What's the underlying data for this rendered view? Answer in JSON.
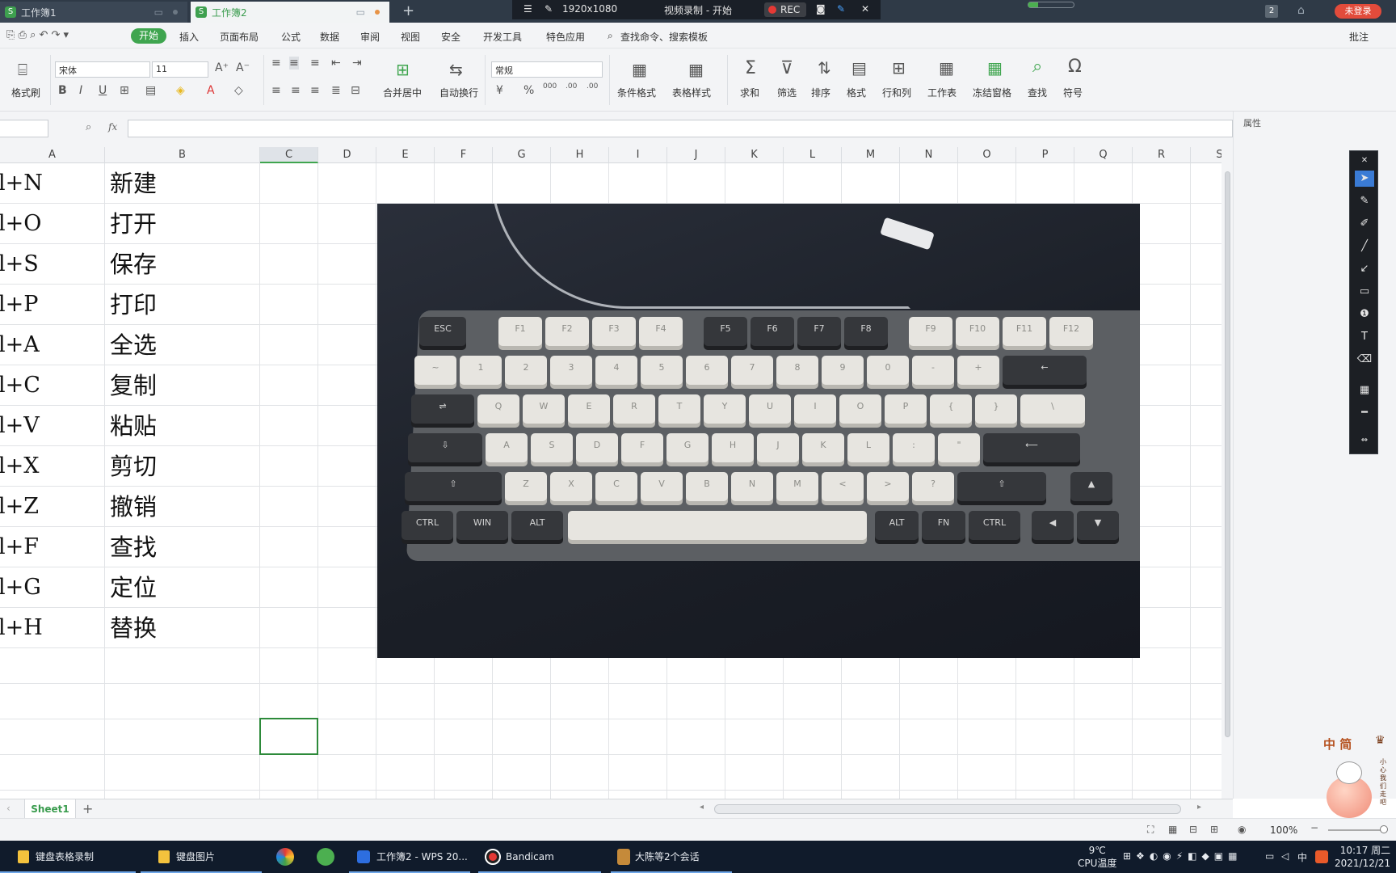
{
  "titlebar": {
    "tabs": [
      {
        "label": "工作簿1",
        "active": false
      },
      {
        "label": "工作簿2",
        "active": true
      }
    ],
    "new_tab": "+",
    "window_count": "2",
    "login_label": "未登录"
  },
  "recorder": {
    "menu_icon": "menu-icon",
    "pin_icon": "pin-icon",
    "resolution": "1920x1080",
    "title": "视频录制 - 开始",
    "rec_label": "REC",
    "camera_icon": "camera-icon",
    "pen_icon": "pen-icon",
    "close_icon": "close-icon"
  },
  "menu": {
    "items": [
      "开始",
      "插入",
      "页面布局",
      "公式",
      "数据",
      "审阅",
      "视图",
      "安全",
      "开发工具",
      "特色应用"
    ],
    "search": "查找命令、搜索模板",
    "comment": "批注"
  },
  "ribbon": {
    "format_painter": "格式刷",
    "font_name": "宋体",
    "font_size": "11",
    "number_format": "常规",
    "merge_center": "合并居中",
    "wrap_text": "自动换行",
    "cond_format": "条件格式",
    "table_style": "表格样式",
    "sum": "求和",
    "filter": "筛选",
    "sort": "排序",
    "format": "格式",
    "row_col": "行和列",
    "worksheet": "工作表",
    "freeze": "冻结窗格",
    "find": "查找",
    "symbol": "符号",
    "percent": "%",
    "thousands": "000",
    "dec_inc": ".00",
    "dec_dec": ".00"
  },
  "formula_bar": {
    "fx_label": "fx",
    "value": "",
    "properties": "属性"
  },
  "columns": [
    "A",
    "B",
    "C",
    "D",
    "E",
    "F",
    "G",
    "H",
    "I",
    "J",
    "K",
    "L",
    "M",
    "N",
    "O",
    "P",
    "Q",
    "R",
    "S"
  ],
  "rows": [
    {
      "a": "l+N",
      "b": "新建"
    },
    {
      "a": "l+O",
      "b": "打开"
    },
    {
      "a": "l+S",
      "b": "保存"
    },
    {
      "a": "l+P",
      "b": "打印"
    },
    {
      "a": "l+A",
      "b": "全选"
    },
    {
      "a": "l+C",
      "b": "复制"
    },
    {
      "a": "l+V",
      "b": "粘贴"
    },
    {
      "a": "l+X",
      "b": "剪切"
    },
    {
      "a": "l+Z",
      "b": "撤销"
    },
    {
      "a": "l+F",
      "b": "查找"
    },
    {
      "a": "l+G",
      "b": "定位"
    },
    {
      "a": "l+H",
      "b": "替换"
    }
  ],
  "keyboard_image": {
    "row_fn": [
      "ESC",
      "F1",
      "F2",
      "F3",
      "F4",
      "F5",
      "F6",
      "F7",
      "F8",
      "F9",
      "F10",
      "F11",
      "F12"
    ],
    "row_num": [
      "~",
      "1",
      "2",
      "3",
      "4",
      "5",
      "6",
      "7",
      "8",
      "9",
      "0",
      "-",
      "+",
      "←"
    ],
    "row_q": [
      "⇌",
      "Q",
      "W",
      "E",
      "R",
      "T",
      "Y",
      "U",
      "I",
      "O",
      "P",
      "{",
      "}",
      "\\"
    ],
    "row_a": [
      "⇩",
      "A",
      "S",
      "D",
      "F",
      "G",
      "H",
      "J",
      "K",
      "L",
      ":",
      "\"",
      "⟵"
    ],
    "row_z": [
      "⇧",
      "Z",
      "X",
      "C",
      "V",
      "B",
      "N",
      "M",
      "<",
      ">",
      "?",
      "⇧",
      "▲"
    ],
    "row_ctrl": [
      "CTRL",
      "WIN",
      "ALT",
      "",
      "ALT",
      "FN",
      "CTRL",
      "◀",
      "▼"
    ]
  },
  "sheet_tabs": {
    "sheets": [
      "Sheet1"
    ],
    "add": "+"
  },
  "status": {
    "zoom": "100%"
  },
  "taskbar": {
    "items": [
      "键盘表格录制",
      "键盘图片",
      "工作簿2 - WPS 20...",
      "Bandicam",
      "大陈等2个会话"
    ],
    "temp": "9℃",
    "cpu_label": "CPU温度",
    "ime": "中",
    "time": "10:17 周二",
    "date": "2021/12/21"
  },
  "mascot": {
    "text": "中 简",
    "side": "小心我们走吧"
  },
  "colors": {
    "accent": "#3fa54f",
    "titlebar": "#2f3a47",
    "taskbar": "#101b2b",
    "rec": "#e53935",
    "login": "#e24b3b"
  }
}
